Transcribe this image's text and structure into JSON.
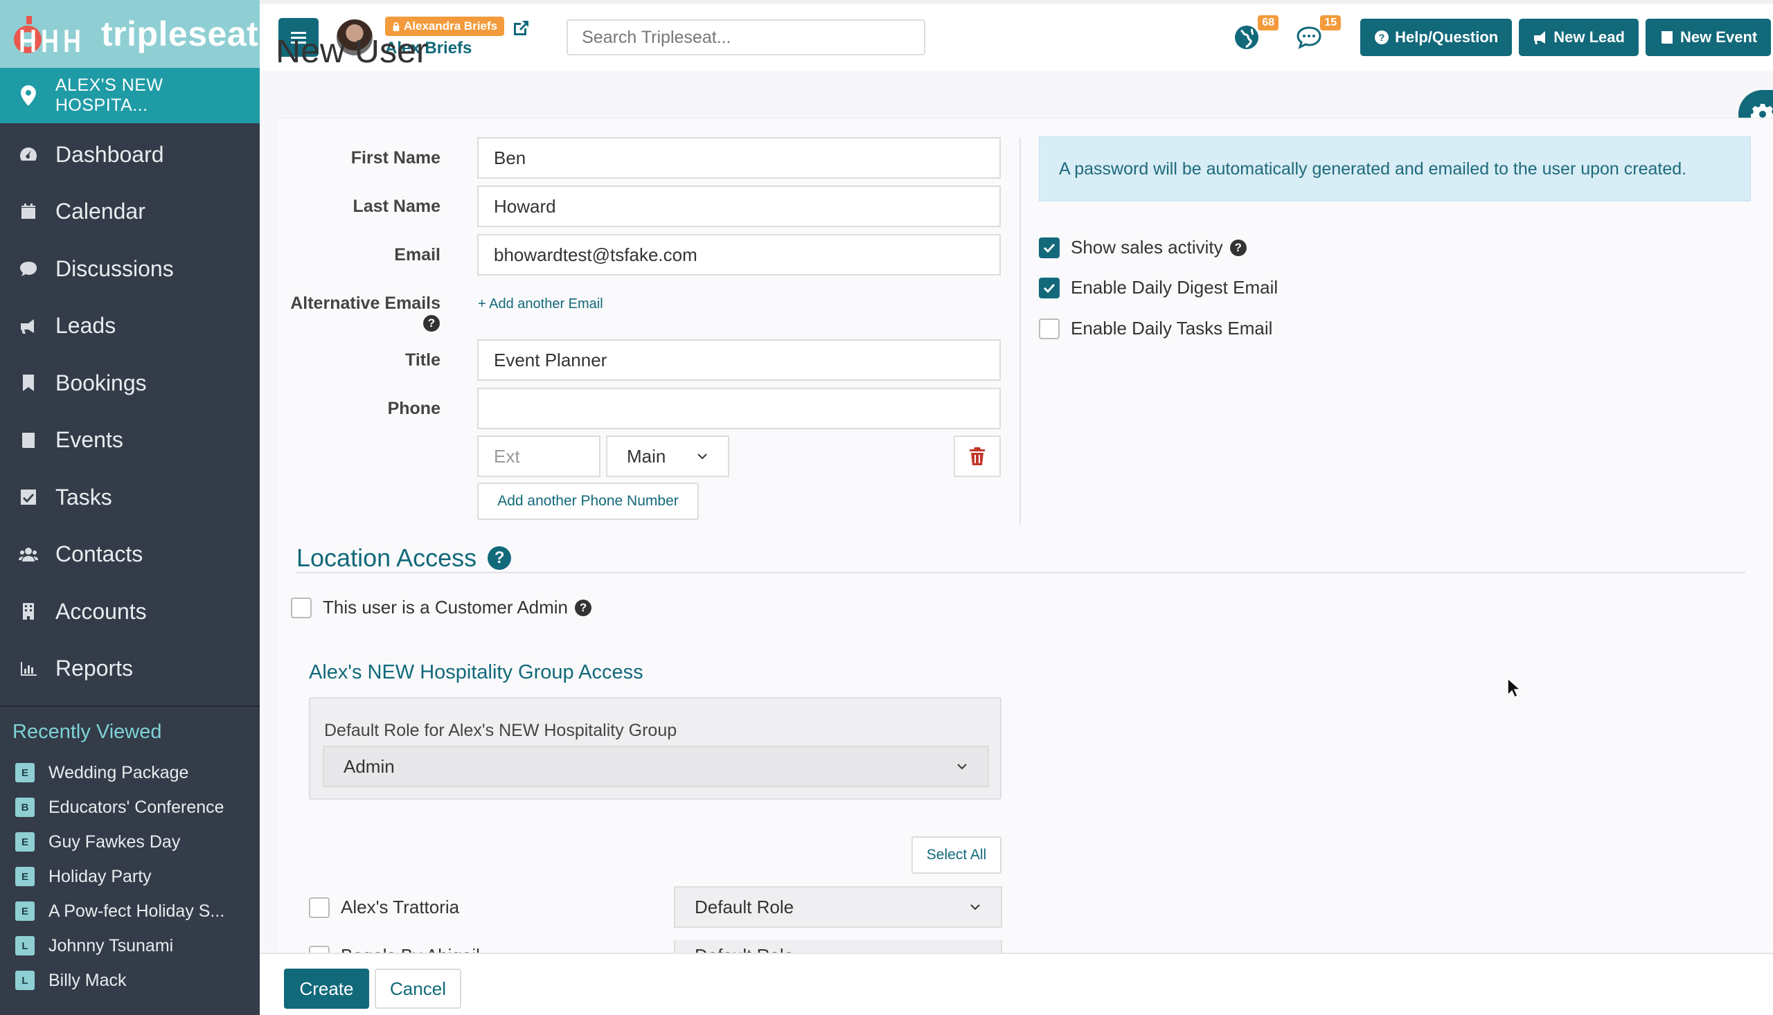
{
  "brand": {
    "name": "tripleseat"
  },
  "location": {
    "name": "ALEX'S NEW HOSPITA..."
  },
  "sidebar": {
    "items": [
      {
        "label": "Dashboard",
        "icon": "dashboard-icon"
      },
      {
        "label": "Calendar",
        "icon": "calendar-icon"
      },
      {
        "label": "Discussions",
        "icon": "comment-icon"
      },
      {
        "label": "Leads",
        "icon": "bullhorn-icon"
      },
      {
        "label": "Bookings",
        "icon": "bookmark-icon"
      },
      {
        "label": "Events",
        "icon": "book-icon"
      },
      {
        "label": "Tasks",
        "icon": "check-square-icon"
      },
      {
        "label": "Contacts",
        "icon": "users-icon"
      },
      {
        "label": "Accounts",
        "icon": "building-icon"
      },
      {
        "label": "Reports",
        "icon": "bar-chart-icon"
      }
    ],
    "recent_title": "Recently Viewed",
    "recent": [
      {
        "badge": "E",
        "label": "Wedding Package"
      },
      {
        "badge": "B",
        "label": "Educators' Conference"
      },
      {
        "badge": "E",
        "label": "Guy Fawkes Day"
      },
      {
        "badge": "E",
        "label": "Holiday Party"
      },
      {
        "badge": "E",
        "label": "A Pow-fect Holiday S..."
      },
      {
        "badge": "L",
        "label": "Johnny Tsunami"
      },
      {
        "badge": "L",
        "label": "Billy Mack"
      }
    ]
  },
  "header": {
    "impersonating": "Alexandra Briefs",
    "user_name": "Alex Briefs",
    "search_placeholder": "Search Tripleseat...",
    "notifications_count": "68",
    "messages_count": "15",
    "help_label": "Help/Question",
    "new_lead_label": "New Lead",
    "new_event_label": "New Event"
  },
  "page": {
    "title_fragment": "New User"
  },
  "form": {
    "first_name_label": "First Name",
    "first_name": "Ben",
    "last_name_label": "Last Name",
    "last_name": "Howard",
    "email_label": "Email",
    "email": "bhowardtest@tsfake.com",
    "alt_emails_label": "Alternative Emails",
    "add_email_link": "+ Add another Email",
    "title_label": "Title",
    "title": "Event Planner",
    "phone_label": "Phone",
    "phone": "",
    "ext_placeholder": "Ext",
    "phone_type": "Main",
    "add_phone_label": "Add another Phone Number",
    "password_note": "A password will be automatically generated and emailed to the user upon created.",
    "options": [
      {
        "label": "Show sales activity",
        "checked": true,
        "help": true
      },
      {
        "label": "Enable Daily Digest Email",
        "checked": true,
        "help": false
      },
      {
        "label": "Enable Daily Tasks Email",
        "checked": false,
        "help": false
      }
    ]
  },
  "access": {
    "section_title": "Location Access",
    "customer_admin_label": "This user is a Customer Admin",
    "group_title": "Alex's NEW Hospitality Group Access",
    "default_role_label": "Default Role for Alex's NEW Hospitality Group",
    "default_role": "Admin",
    "select_all_label": "Select All",
    "locations": [
      {
        "name": "Alex's Trattoria",
        "role": "Default Role"
      },
      {
        "name": "Bagels By Abigail",
        "role": "Default Role"
      }
    ]
  },
  "footer": {
    "create_label": "Create",
    "cancel_label": "Cancel"
  },
  "colors": {
    "primary": "#11697a",
    "accent": "#f39b3c",
    "sidebar": "#333c48",
    "brand_bg": "#8fcfd3",
    "location_bg": "#1f9ba6"
  }
}
